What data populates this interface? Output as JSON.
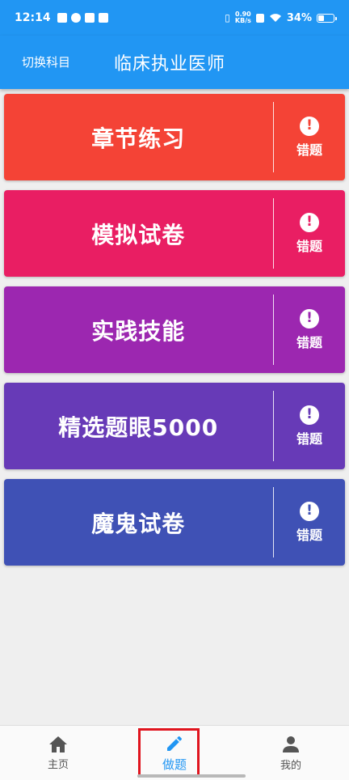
{
  "status_bar": {
    "time": "12:14",
    "net_speed_value": "0.90",
    "net_speed_unit": "KB/s",
    "battery": "34%"
  },
  "app_bar": {
    "switch_label": "切换科目",
    "title": "临床执业医师"
  },
  "cards": [
    {
      "title": "章节练习",
      "side_label": "错题",
      "color": "#f44336"
    },
    {
      "title": "模拟试卷",
      "side_label": "错题",
      "color": "#e91e63"
    },
    {
      "title": "实践技能",
      "side_label": "错题",
      "color": "#9c27b0"
    },
    {
      "title": "精选题眼5000",
      "side_label": "错题",
      "color": "#673ab7"
    },
    {
      "title": "魔鬼试卷",
      "side_label": "错题",
      "color": "#3f51b5"
    }
  ],
  "bottom_nav": {
    "items": [
      {
        "label": "主页",
        "icon": "home-icon"
      },
      {
        "label": "做题",
        "icon": "pencil-icon",
        "active": true
      },
      {
        "label": "我的",
        "icon": "person-icon"
      }
    ]
  },
  "colors": {
    "primary": "#2196f3",
    "background": "#efefef",
    "highlight": "#e0141e"
  }
}
